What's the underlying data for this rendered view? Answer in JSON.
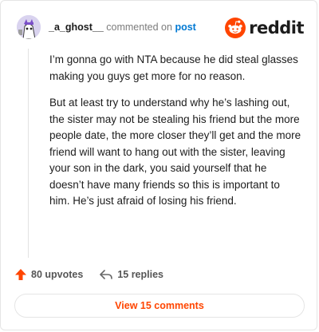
{
  "header": {
    "username": "_a_ghost__",
    "commented_text": "commented on",
    "post_link": "post",
    "brand": "reddit"
  },
  "comment": {
    "paragraphs": [
      "I’m gonna go with NTA because he did steal glasses making you guys get more for no reason.",
      "But at least try to understand why he’s lashing out, the sister may not be stealing his friend but the more people date, the more closer they’ll get and the more friend will want to hang out with the sister, leaving your son in the dark, you said yourself that he doesn’t have many friends so this is important to him. He’s just afraid of losing his friend."
    ]
  },
  "actions": {
    "upvotes": "80 upvotes",
    "replies": "15 replies"
  },
  "view_comments": "View 15 comments",
  "colors": {
    "brand_orange": "#ff4500",
    "link_blue": "#0079d3",
    "text": "#1c1c1c",
    "muted": "#7c7c7c"
  },
  "icons": {
    "avatar": "user-avatar",
    "brand": "reddit-snoo-icon",
    "upvote": "upvote-arrow-icon",
    "reply": "reply-arrow-icon"
  }
}
